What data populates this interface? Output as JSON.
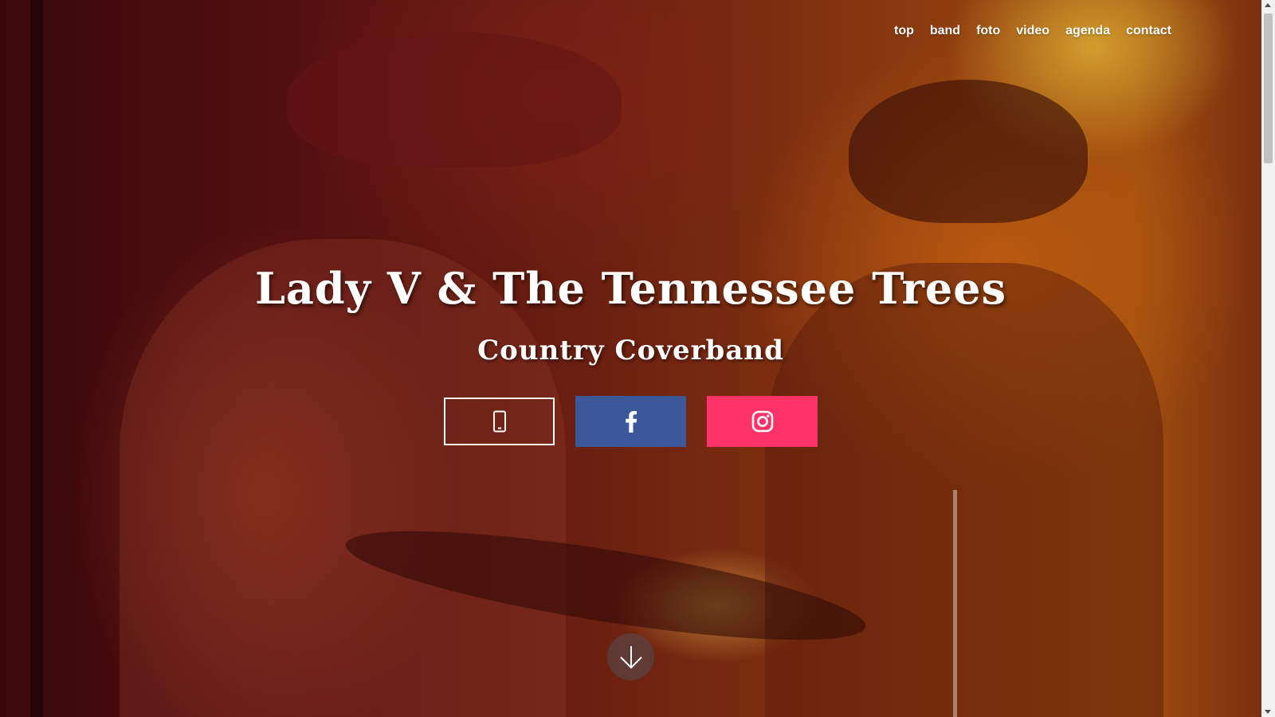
{
  "nav": {
    "items": [
      {
        "label": "top"
      },
      {
        "label": "band"
      },
      {
        "label": "foto"
      },
      {
        "label": "video"
      },
      {
        "label": "agenda"
      },
      {
        "label": "contact"
      }
    ]
  },
  "hero": {
    "title": "Lady V & The Tennessee Trees",
    "subtitle": "Country Coverband"
  },
  "social_buttons": [
    {
      "icon": "mobile-phone-icon",
      "color": "#ffffff"
    },
    {
      "icon": "facebook-icon",
      "color": "#3b5998"
    },
    {
      "icon": "instagram-icon",
      "color": "#ff3368"
    }
  ],
  "scroll_down": {
    "icon": "arrow-down-icon"
  }
}
